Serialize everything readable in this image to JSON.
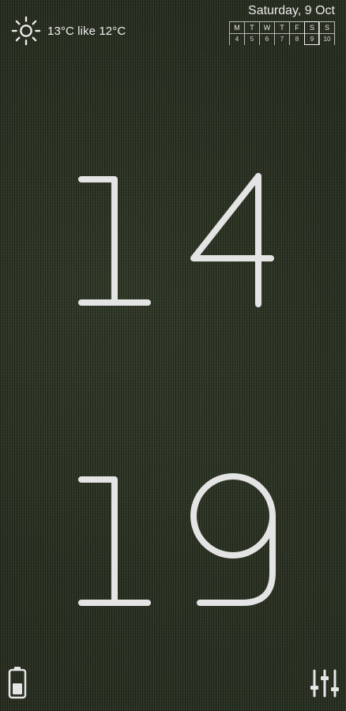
{
  "weather": {
    "text": "13°C like 12°C",
    "icon": "sun-icon"
  },
  "date": {
    "text": "Saturday, 9 Oct"
  },
  "week": {
    "days": [
      {
        "letter": "M",
        "num": "4"
      },
      {
        "letter": "T",
        "num": "5"
      },
      {
        "letter": "W",
        "num": "6"
      },
      {
        "letter": "T",
        "num": "7"
      },
      {
        "letter": "F",
        "num": "8"
      },
      {
        "letter": "S",
        "num": "9"
      },
      {
        "letter": "S",
        "num": "10"
      }
    ],
    "today_index": 5
  },
  "clock": {
    "hours": "14",
    "minutes": "19"
  },
  "icons": {
    "battery": "battery-icon",
    "settings": "sliders-icon"
  },
  "colors": {
    "foreground": "#e6e6e6",
    "background": "#2a3222"
  }
}
